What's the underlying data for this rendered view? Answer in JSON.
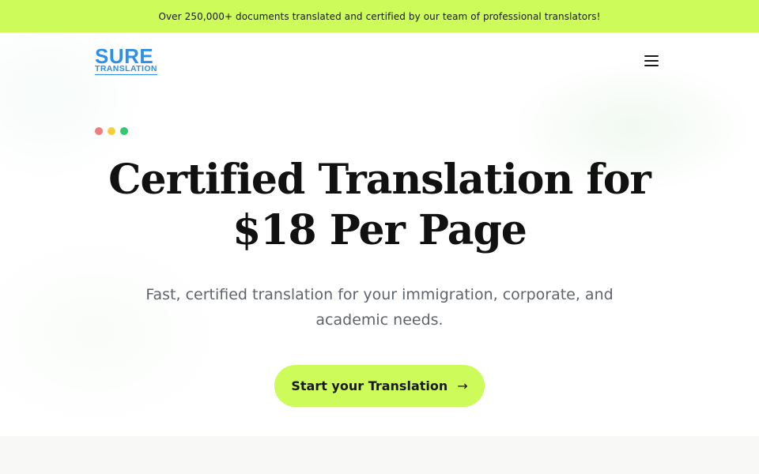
{
  "banner": {
    "text": "Over 250,000+ documents translated and certified by our team of professional translators!"
  },
  "header": {
    "logo_main": "SURE",
    "logo_sub": "TRANSLATION",
    "menu_icon": "hamburger-menu-icon"
  },
  "hero": {
    "dots": [
      {
        "color": "#f07c7c"
      },
      {
        "color": "#f5cf3c"
      },
      {
        "color": "#34c76f"
      }
    ],
    "headline": "Certified Translation for $18 Per Page",
    "subtext": "Fast, certified translation for your immigration, corporate, and academic needs.",
    "cta_label": "Start your Translation",
    "cta_icon": "arrow-right-icon"
  },
  "colors": {
    "accent": "#ccfb5a",
    "brand": "#2d8fe6",
    "text": "#111111",
    "muted": "#5f646b"
  }
}
